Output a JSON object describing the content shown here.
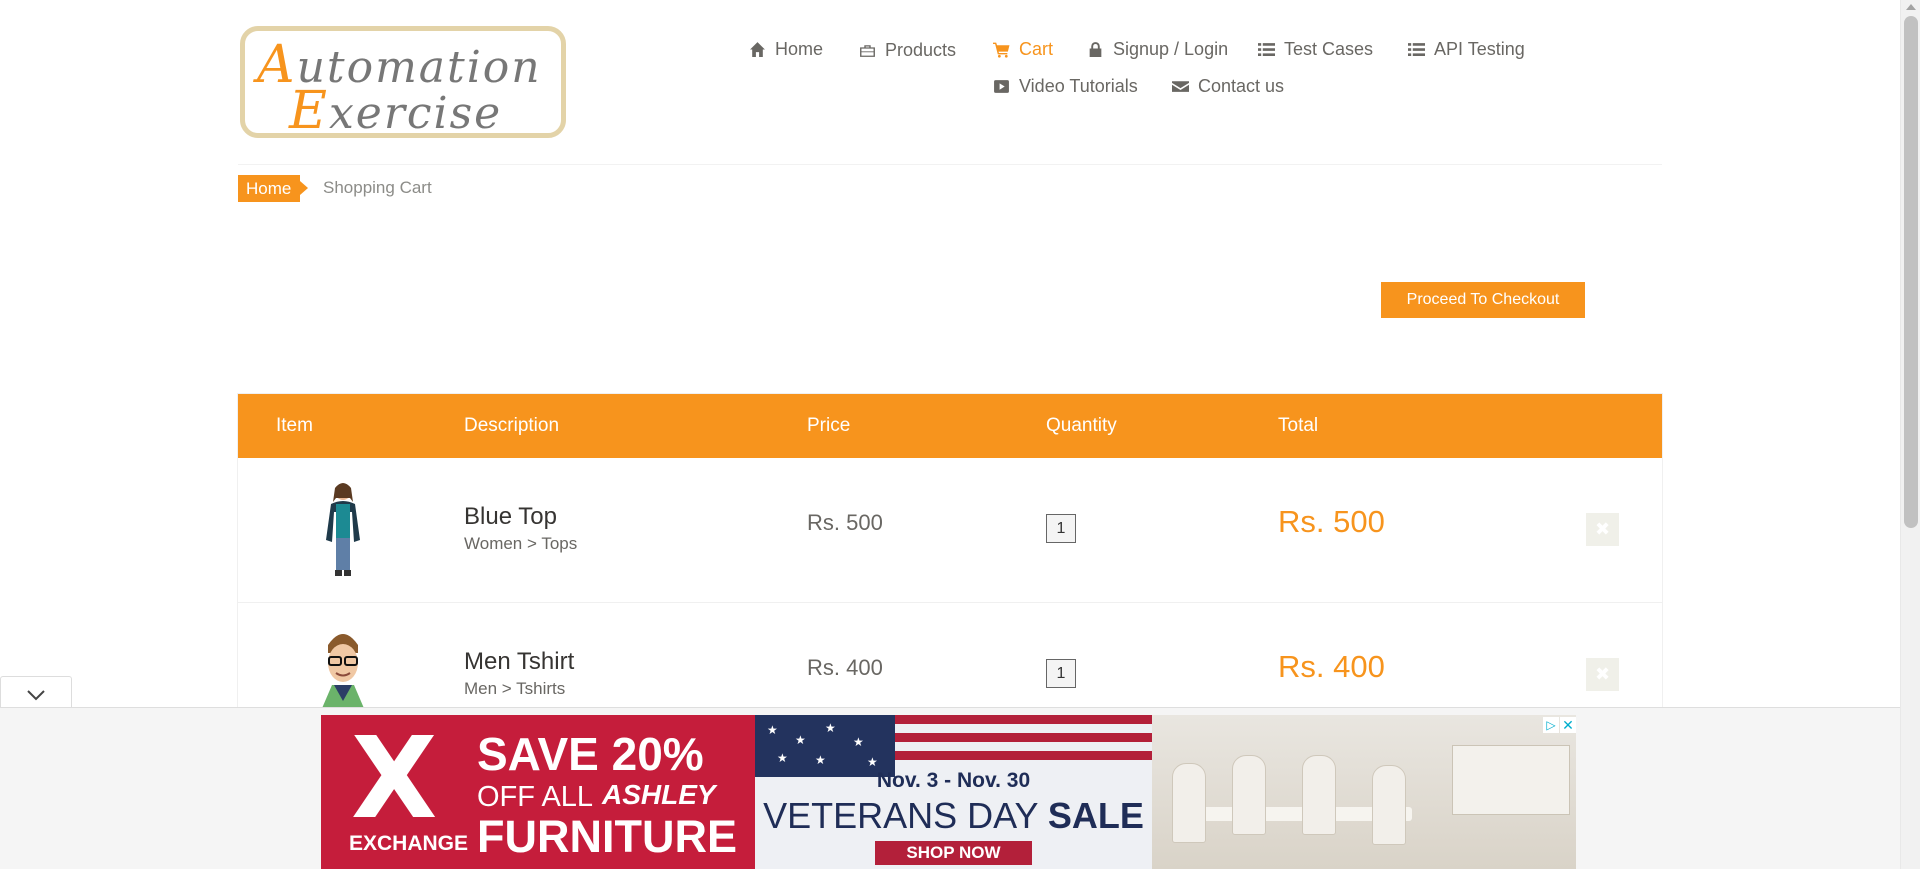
{
  "logo": {
    "line1_cap": "A",
    "line1_rest": "utomation",
    "line2_cap": "E",
    "line2_rest": "xercise"
  },
  "nav": {
    "items": [
      {
        "label": "Home",
        "icon": "home-icon"
      },
      {
        "label": "Products",
        "icon": "briefcase-icon"
      },
      {
        "label": "Cart",
        "icon": "shopping-cart-icon",
        "active": true
      },
      {
        "label": "Signup / Login",
        "icon": "lock-icon"
      },
      {
        "label": "Test Cases",
        "icon": "list-icon"
      },
      {
        "label": "API Testing",
        "icon": "list-icon"
      },
      {
        "label": "Video Tutorials",
        "icon": "youtube-play-icon"
      },
      {
        "label": "Contact us",
        "icon": "envelope-icon"
      }
    ]
  },
  "breadcrumb": {
    "home": "Home",
    "current": "Shopping Cart"
  },
  "checkout_button": "Proceed To Checkout",
  "cart": {
    "headers": [
      "Item",
      "Description",
      "Price",
      "Quantity",
      "Total"
    ],
    "rows": [
      {
        "name": "Blue Top",
        "category": "Women > Tops",
        "price": "Rs. 500",
        "quantity": "1",
        "total": "Rs. 500",
        "delete_icon": "times-icon"
      },
      {
        "name": "Men Tshirt",
        "category": "Men > Tshirts",
        "price": "Rs. 400",
        "quantity": "1",
        "total": "Rs. 400",
        "delete_icon": "times-icon"
      }
    ]
  },
  "ad": {
    "exchange_x": "X",
    "exchange_label": "EXCHANGE",
    "save": "SAVE 20%",
    "off_all": "OFF ALL",
    "brand": "ASHLEY",
    "furniture": "FURNITURE",
    "dates": "Nov. 3 - Nov. 30",
    "sale_light": "VETERANS DAY ",
    "sale_bold": "SALE",
    "shop_now": "SHOP NOW",
    "info_icon": "adchoices-icon",
    "close_icon": "close-icon"
  },
  "colors": {
    "accent": "#f7941d",
    "text": "#696763",
    "ad_red": "#c51d3b",
    "ad_navy": "#1f2d57"
  }
}
